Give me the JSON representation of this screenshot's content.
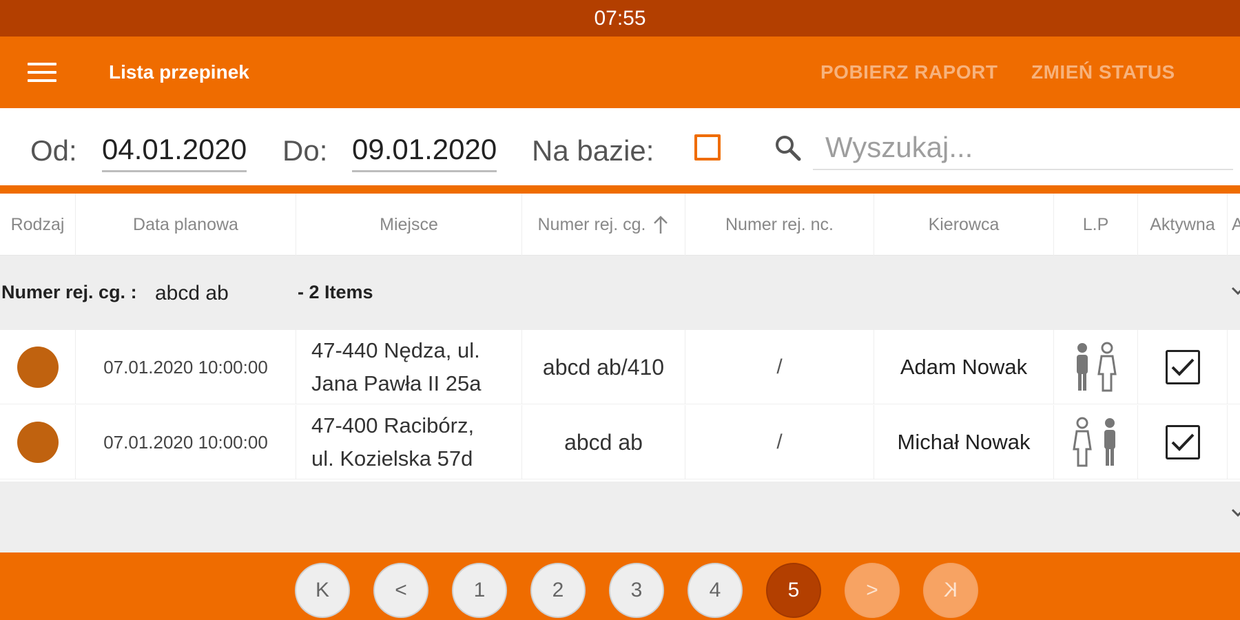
{
  "status_bar": {
    "time": "07:55"
  },
  "app_bar": {
    "title": "Lista przepinek",
    "download_report": "POBIERZ RAPORT",
    "change_status": "ZMIEŃ STATUS"
  },
  "filters": {
    "from_label": "Od:",
    "from_value": "04.01.2020",
    "to_label": "Do:",
    "to_value": "09.01.2020",
    "on_base_label": "Na bazie:",
    "on_base_checked": false,
    "search_placeholder": "Wyszukaj..."
  },
  "columns": [
    "Rodzaj",
    "Data planowa",
    "Miejsce",
    "Numer rej. cg.",
    "Numer rej. nc.",
    "Kierowca",
    "L.P",
    "Aktywna",
    "A"
  ],
  "sorted_column": "Numer rej. cg.",
  "group": {
    "key_label": "Numer rej. cg. :",
    "key_value": "abcd ab",
    "count_label": "- 2 Items"
  },
  "rows": [
    {
      "type_color": "#c0620f",
      "date": "07.01.2020 10:00:00",
      "place_line1": "47-440 Nędza, ul.",
      "place_line2": "Jana Pawła II 25a",
      "reg_cg": "abcd ab/410",
      "reg_nc": "/",
      "driver": "Adam Nowak",
      "lp_icon": "filled-person-then-outline-person-icon",
      "active": true
    },
    {
      "type_color": "#c0620f",
      "date": "07.01.2020 10:00:00",
      "place_line1": "47-400 Racibórz,",
      "place_line2": "ul. Kozielska 57d",
      "reg_cg": "abcd ab",
      "reg_nc": "/",
      "driver": "Michał Nowak",
      "lp_icon": "outline-person-then-filled-person-icon",
      "active": true
    }
  ],
  "pager": {
    "first": "K",
    "prev": "<",
    "pages": [
      "1",
      "2",
      "3",
      "4",
      "5"
    ],
    "current_page": "5",
    "next": ">",
    "last": "K"
  }
}
